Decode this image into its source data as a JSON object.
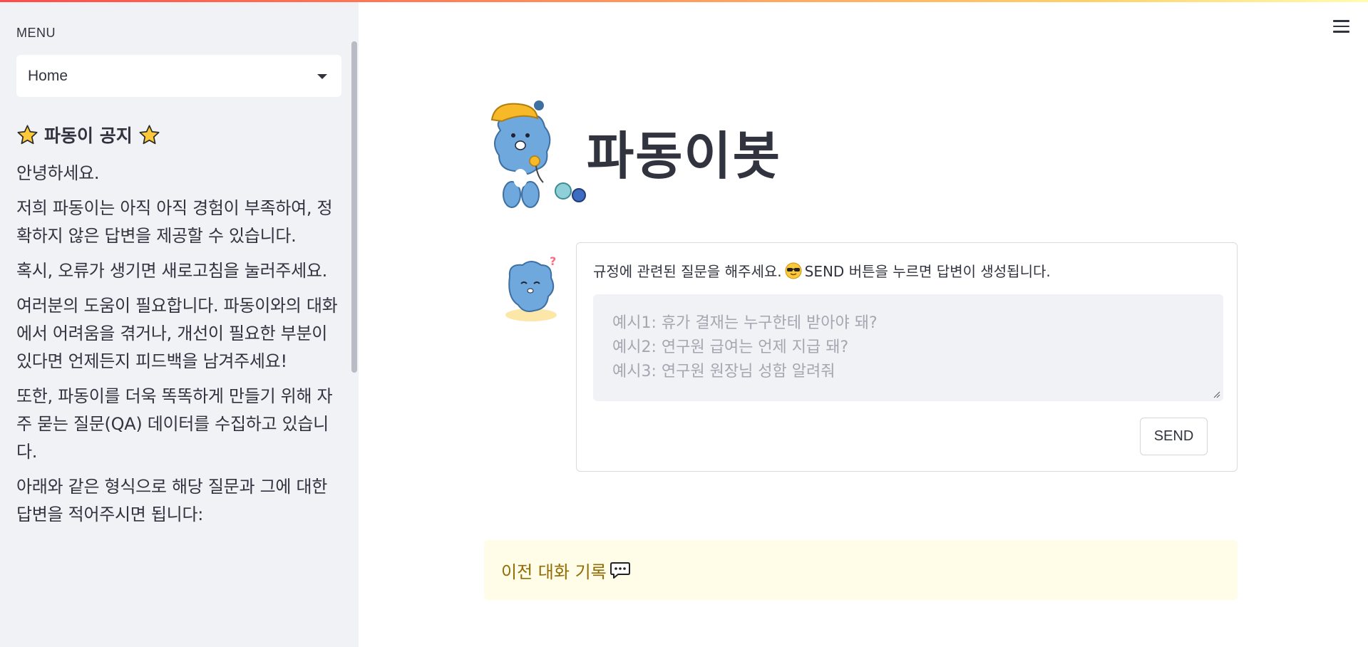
{
  "sidebar": {
    "menu_label": "MENU",
    "select_value": "Home",
    "notice_title": "파동이 공지",
    "paragraphs": [
      "안녕하세요.",
      "저희 파동이는 아직 아직 경험이 부족하여, 정확하지 않은 답변을 제공할 수 있습니다.",
      "혹시, 오류가 생기면 새로고침을 눌러주세요.",
      "여러분의 도움이 필요합니다. 파동이와의 대화에서 어려움을 겪거나, 개선이 필요한 부분이 있다면 언제든지 피드백을 남겨주세요!",
      "또한, 파동이를 더욱 똑똑하게 만들기 위해 자주 묻는 질문(QA) 데이터를 수집하고 있습니다.",
      "아래와 같은 형식으로 해당 질문과 그에 대한 답변을 적어주시면 됩니다:"
    ]
  },
  "main": {
    "title": "파동이봇",
    "instruction_before": "규정에 관련된 질문을 해주세요.",
    "instruction_after": "SEND 버튼을 누르면 답변이 생성됩니다.",
    "textarea_placeholder": "예시1: 휴가 결재는 누구한테 받아야 돼?\n예시2: 연구원 급여는 언제 지급 돼?\n예시3: 연구원 원장님 성함 알려줘",
    "send_label": "SEND",
    "history_label": "이전 대화 기록"
  },
  "icons": {
    "star": "star-icon",
    "menu": "hamburger-menu-icon",
    "chat": "speech-bubble-icon",
    "cool": "sunglasses-emoji-icon"
  },
  "colors": {
    "sidebar_bg": "#f0f2f6",
    "history_bg": "#fffce7",
    "history_text": "#926c05",
    "text": "#31333f"
  }
}
